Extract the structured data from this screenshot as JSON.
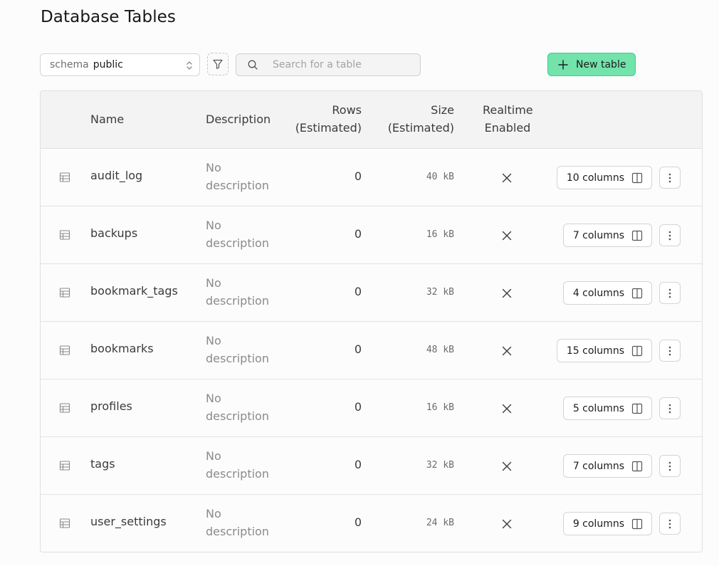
{
  "page": {
    "title": "Database Tables"
  },
  "toolbar": {
    "schema_label": "schema",
    "schema_value": "public",
    "search_placeholder": "Search for a table",
    "new_table_label": "New table"
  },
  "colors": {
    "accent": "#72e3ab",
    "accent_border": "#3ecf8e"
  },
  "table": {
    "headers": {
      "name": "Name",
      "description": "Description",
      "rows_line1": "Rows",
      "rows_line2": "(Estimated)",
      "size_line1": "Size",
      "size_line2": "(Estimated)",
      "realtime_line1": "Realtime",
      "realtime_line2": "Enabled"
    },
    "rows": [
      {
        "name": "audit_log",
        "desc1": "No",
        "desc2": "description",
        "rows": "0",
        "size": "40 kB",
        "columns": "10 columns"
      },
      {
        "name": "backups",
        "desc1": "No",
        "desc2": "description",
        "rows": "0",
        "size": "16 kB",
        "columns": "7 columns"
      },
      {
        "name": "bookmark_tags",
        "desc1": "No",
        "desc2": "description",
        "rows": "0",
        "size": "32 kB",
        "columns": "4 columns"
      },
      {
        "name": "bookmarks",
        "desc1": "No",
        "desc2": "description",
        "rows": "0",
        "size": "48 kB",
        "columns": "15 columns"
      },
      {
        "name": "profiles",
        "desc1": "No",
        "desc2": "description",
        "rows": "0",
        "size": "16 kB",
        "columns": "5 columns"
      },
      {
        "name": "tags",
        "desc1": "No",
        "desc2": "description",
        "rows": "0",
        "size": "32 kB",
        "columns": "7 columns"
      },
      {
        "name": "user_settings",
        "desc1": "No",
        "desc2": "description",
        "rows": "0",
        "size": "24 kB",
        "columns": "9 columns"
      }
    ]
  }
}
